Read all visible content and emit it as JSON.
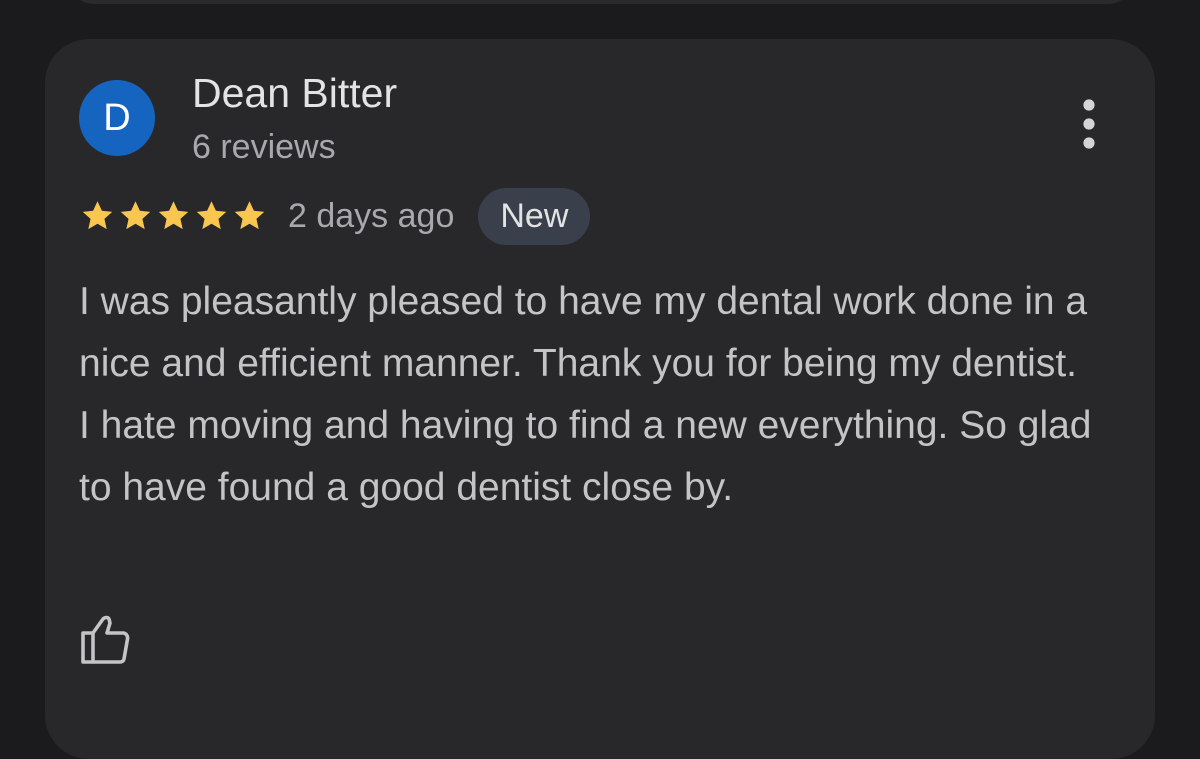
{
  "review": {
    "author": {
      "initial": "D",
      "name": "Dean Bitter",
      "review_count": "6 reviews",
      "avatar_color": "#1565c0"
    },
    "rating": 5,
    "max_rating": 5,
    "star_icon": "star-icon",
    "star_color": "#f9c74f",
    "date": "2 days ago",
    "badge": "New",
    "body_paragraphs": [
      "I was pleasantly pleased to have my dental work done in a nice and efficient manner. Thank you for being my dentist.",
      "I hate moving and having to find a new everything. So glad to have found a good dentist close by."
    ],
    "actions": {
      "menu_icon": "more-vert-icon",
      "like_icon": "thumb-up-icon"
    }
  }
}
